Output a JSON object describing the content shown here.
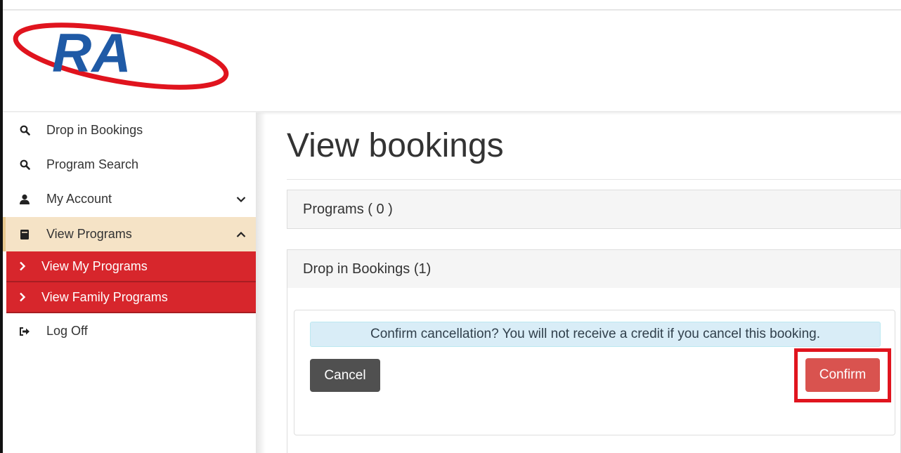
{
  "logo": {
    "text": "RA",
    "ring_color": "#e0141e",
    "text_color": "#1f5aa6"
  },
  "sidebar": {
    "items": [
      {
        "label": "Drop in Bookings",
        "icon": "search-icon"
      },
      {
        "label": "Program Search",
        "icon": "search-icon"
      },
      {
        "label": "My Account",
        "icon": "user-icon",
        "toggle": "chevron-down-icon"
      },
      {
        "label": "View Programs",
        "icon": "book-icon",
        "toggle": "chevron-up-icon",
        "active": true
      },
      {
        "label": "View My Programs",
        "icon": "chevron-right-icon",
        "submenu": true
      },
      {
        "label": "View Family Programs",
        "icon": "chevron-right-icon",
        "submenu": true
      },
      {
        "label": "Log Off",
        "icon": "sign-out-icon"
      }
    ]
  },
  "main": {
    "title": "View bookings",
    "panels": [
      {
        "label": "Programs ( 0 )"
      },
      {
        "label": "Drop in Bookings (1)"
      }
    ],
    "alert": "Confirm cancellation? You will not receive a credit if you cancel this booking.",
    "cancel_label": "Cancel",
    "confirm_label": "Confirm"
  },
  "colors": {
    "submenu_bg": "#d7262c",
    "active_bg": "#f5e3c6",
    "alert_bg": "#d9edf7",
    "confirm_bg": "#d9534f",
    "cancel_bg": "#505050",
    "highlight": "#e0141e"
  }
}
